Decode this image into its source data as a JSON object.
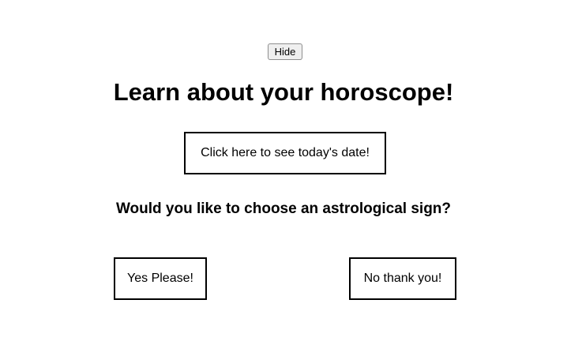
{
  "controls": {
    "hide_label": "Hide"
  },
  "header": {
    "title": "Learn about your horoscope!"
  },
  "actions": {
    "date_label": "Click here to see today's date!"
  },
  "prompt": {
    "question": "Would you like to choose an astrological sign?",
    "yes_label": "Yes Please!",
    "no_label": "No thank you!"
  }
}
